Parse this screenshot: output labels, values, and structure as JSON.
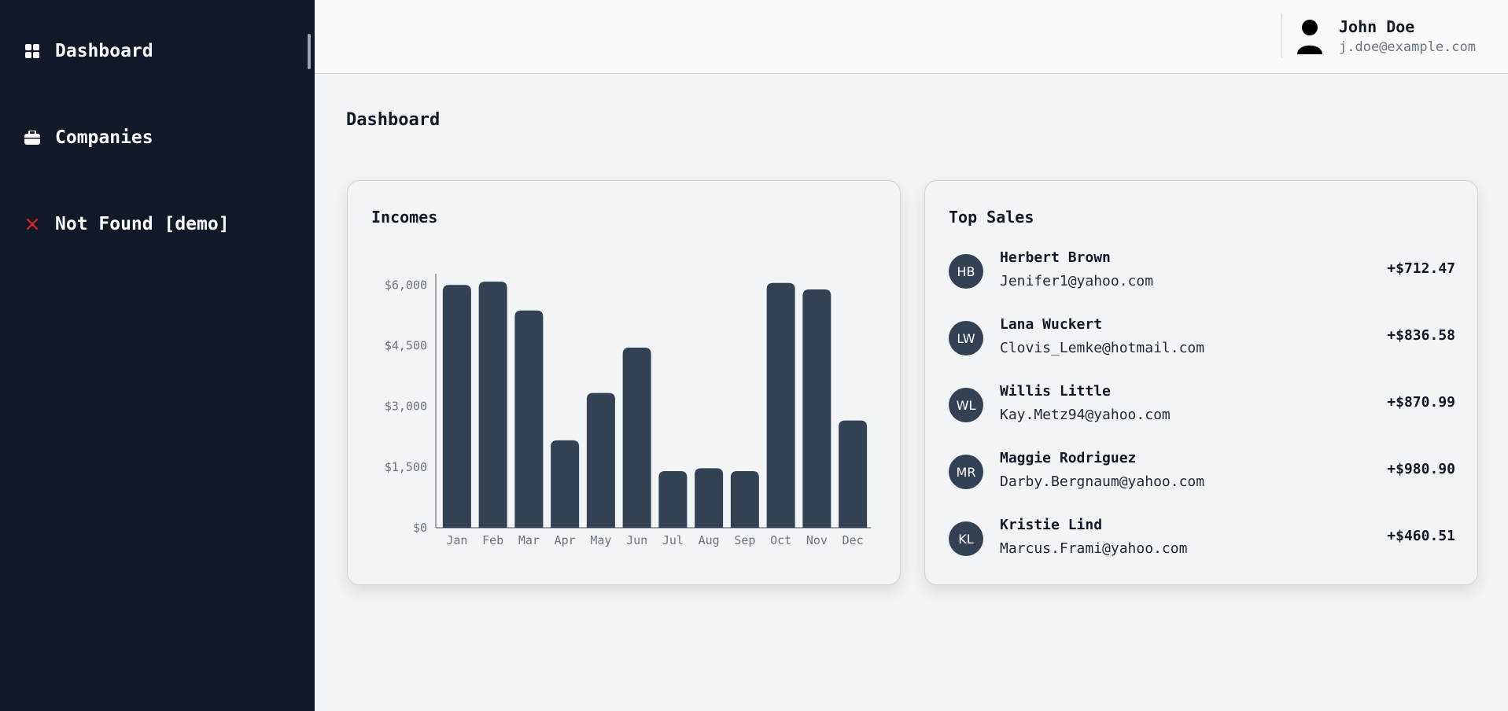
{
  "sidebar": {
    "items": [
      {
        "label": "Dashboard",
        "icon": "grid-icon"
      },
      {
        "label": "Companies",
        "icon": "briefcase-icon"
      },
      {
        "label": "Not Found [demo]",
        "icon": "close-icon",
        "icon_color": "#dc2626"
      }
    ]
  },
  "header": {
    "user": {
      "name": "John Doe",
      "email": "j.doe@example.com",
      "icon": "user-icon"
    }
  },
  "main": {
    "page_title": "Dashboard",
    "incomes": {
      "title": "Incomes"
    },
    "top_sales": {
      "title": "Top Sales",
      "items": [
        {
          "initials": "HB",
          "name": "Herbert Brown",
          "email": "Jenifer1@yahoo.com",
          "amount": "+$712.47"
        },
        {
          "initials": "LW",
          "name": "Lana Wuckert",
          "email": "Clovis_Lemke@hotmail.com",
          "amount": "+$836.58"
        },
        {
          "initials": "WL",
          "name": "Willis Little",
          "email": "Kay.Metz94@yahoo.com",
          "amount": "+$870.99"
        },
        {
          "initials": "MR",
          "name": "Maggie Rodriguez",
          "email": "Darby.Bergnaum@yahoo.com",
          "amount": "+$980.90"
        },
        {
          "initials": "KL",
          "name": "Kristie Lind",
          "email": "Marcus.Frami@yahoo.com",
          "amount": "+$460.51"
        }
      ]
    }
  },
  "colors": {
    "sidebar_bg": "#111827",
    "bar": "#334155",
    "accent_red": "#dc2626"
  },
  "chart_data": {
    "type": "bar",
    "title": "Incomes",
    "categories": [
      "Jan",
      "Feb",
      "Mar",
      "Apr",
      "May",
      "Jun",
      "Jul",
      "Aug",
      "Sep",
      "Oct",
      "Nov",
      "Dec"
    ],
    "values": [
      6000,
      6080,
      5370,
      2160,
      3330,
      4450,
      1400,
      1470,
      1400,
      6050,
      5890,
      2650
    ],
    "yticks": [
      "$0",
      "$1,500",
      "$3,000",
      "$4,500",
      "$6,000"
    ],
    "ytick_values": [
      0,
      1500,
      3000,
      4500,
      6000
    ],
    "ylim": [
      0,
      6200
    ],
    "grid": false,
    "xlabel": "",
    "ylabel": ""
  }
}
